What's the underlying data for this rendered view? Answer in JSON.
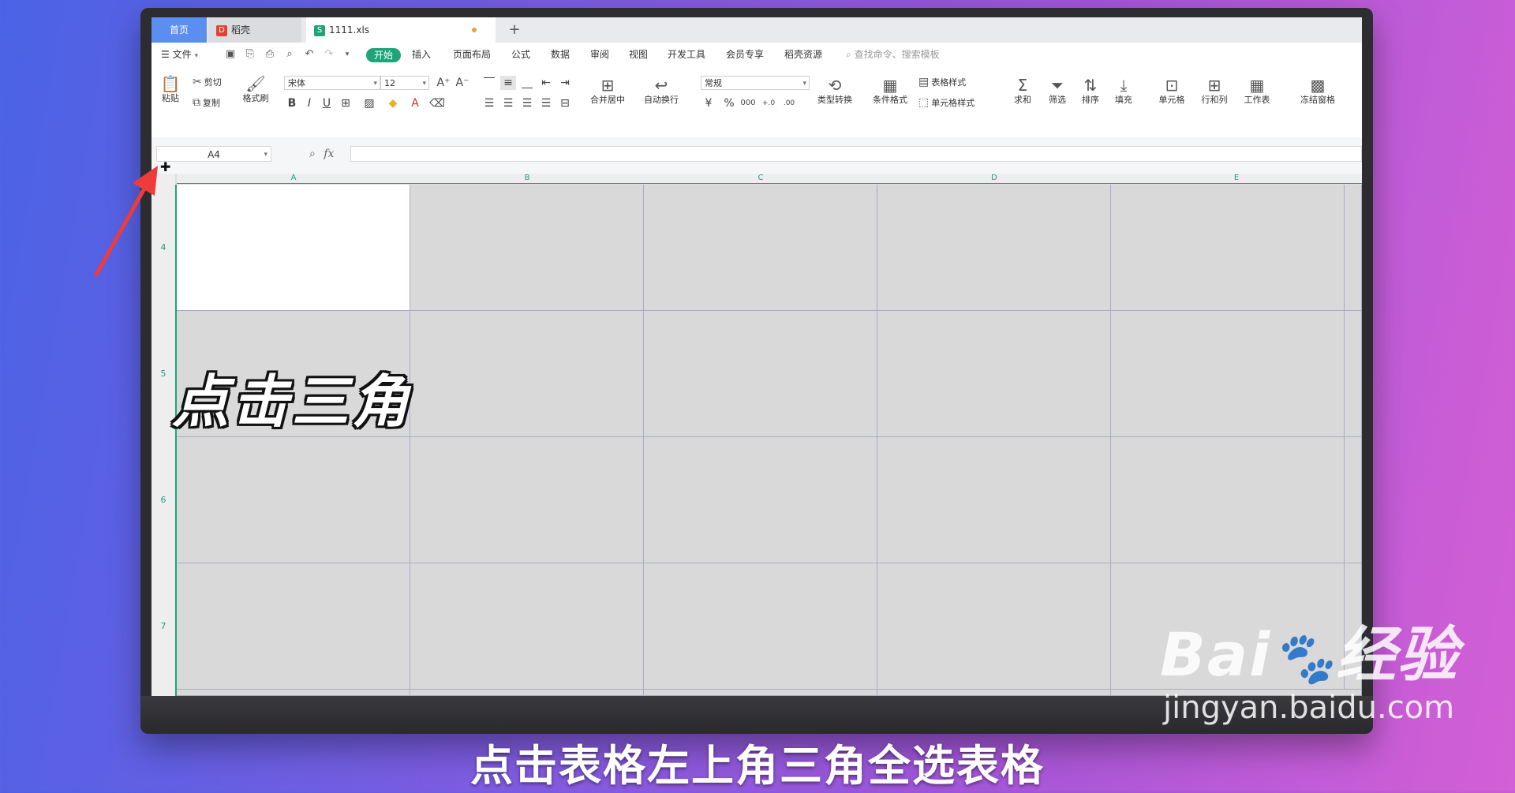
{
  "tabs": {
    "home": "首页",
    "daoke": "稻壳",
    "daoke_badge": "D",
    "file": "1111.xls",
    "file_badge": "S",
    "add": "+"
  },
  "menu": {
    "file_menu": "文件",
    "start": "开始",
    "items": [
      "插入",
      "页面布局",
      "公式",
      "数据",
      "审阅",
      "视图",
      "开发工具",
      "会员专享",
      "稻壳资源"
    ],
    "search_hint": "查找命令、搜索模板"
  },
  "ribbon": {
    "paste": "粘贴",
    "cut": "剪切",
    "copy": "复制",
    "format_painter": "格式刷",
    "font_name": "宋体",
    "font_size": "12",
    "bold": "B",
    "italic": "I",
    "underline": "U",
    "merge_center": "合并居中",
    "wrap_text": "自动换行",
    "number_format": "常规",
    "type_convert": "类型转换",
    "conditional_format": "条件格式",
    "table_style": "表格样式",
    "cell_style": "单元格样式",
    "sum": "求和",
    "filter": "筛选",
    "sort": "排序",
    "fill": "填充",
    "cells": "单元格",
    "row_col": "行和列",
    "worksheet": "工作表",
    "freeze": "冻结窗格",
    "currency": "¥",
    "percent": "%",
    "thousands": "000",
    "inc_decimal": "+.0",
    "dec_decimal": ".00"
  },
  "formula_bar": {
    "name_box": "A4",
    "fx": "fx"
  },
  "grid": {
    "columns": [
      "A",
      "B",
      "C",
      "D",
      "E"
    ],
    "rows": [
      "4",
      "5",
      "6",
      "7"
    ]
  },
  "overlay_title": "点击三角",
  "caption": "点击表格左上角三角全选表格",
  "watermark": {
    "logo": "Bai",
    "logo_tail": "经验",
    "url": "jingyan.baidu.com"
  },
  "colors": {
    "accent": "#1fa47a",
    "arrow": "#ee3b3b",
    "home_tab": "#5b8ef0"
  }
}
